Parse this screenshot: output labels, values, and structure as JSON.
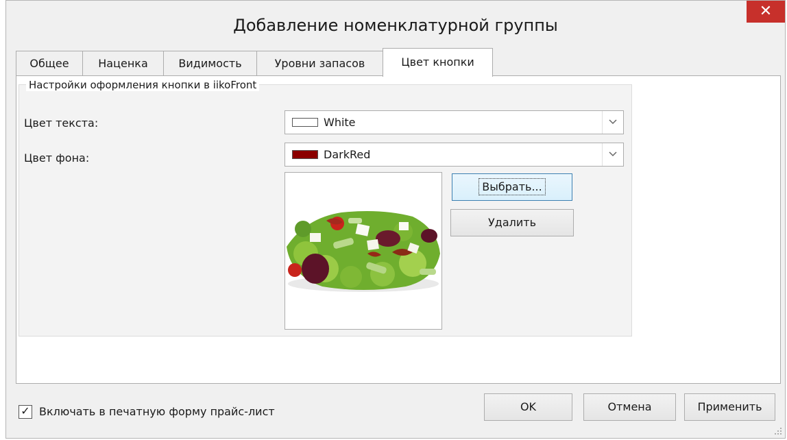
{
  "window": {
    "title": "Добавление номенклатурной группы",
    "close_glyph": "✕"
  },
  "tabs": [
    {
      "label": "Общее",
      "active": false
    },
    {
      "label": "Наценка",
      "active": false
    },
    {
      "label": "Видимость",
      "active": false
    },
    {
      "label": "Уровни запасов",
      "active": false
    },
    {
      "label": "Цвет кнопки",
      "active": true
    }
  ],
  "group": {
    "title": "Настройки оформления кнопки в iikoFront",
    "text_color": {
      "label": "Цвет текста:",
      "value": "White",
      "swatch": "#ffffff"
    },
    "bg_color": {
      "label": "Цвет фона:",
      "value": "DarkRed",
      "swatch": "#8b0000"
    },
    "image_alt": "salad-image",
    "choose_label": "Выбрать...",
    "delete_label": "Удалить"
  },
  "footer": {
    "checkbox_label": "Включать в печатную форму прайс-лист",
    "checked": true,
    "check_glyph": "✓",
    "ok_label": "OK",
    "cancel_label": "Отмена",
    "apply_label": "Применить"
  }
}
